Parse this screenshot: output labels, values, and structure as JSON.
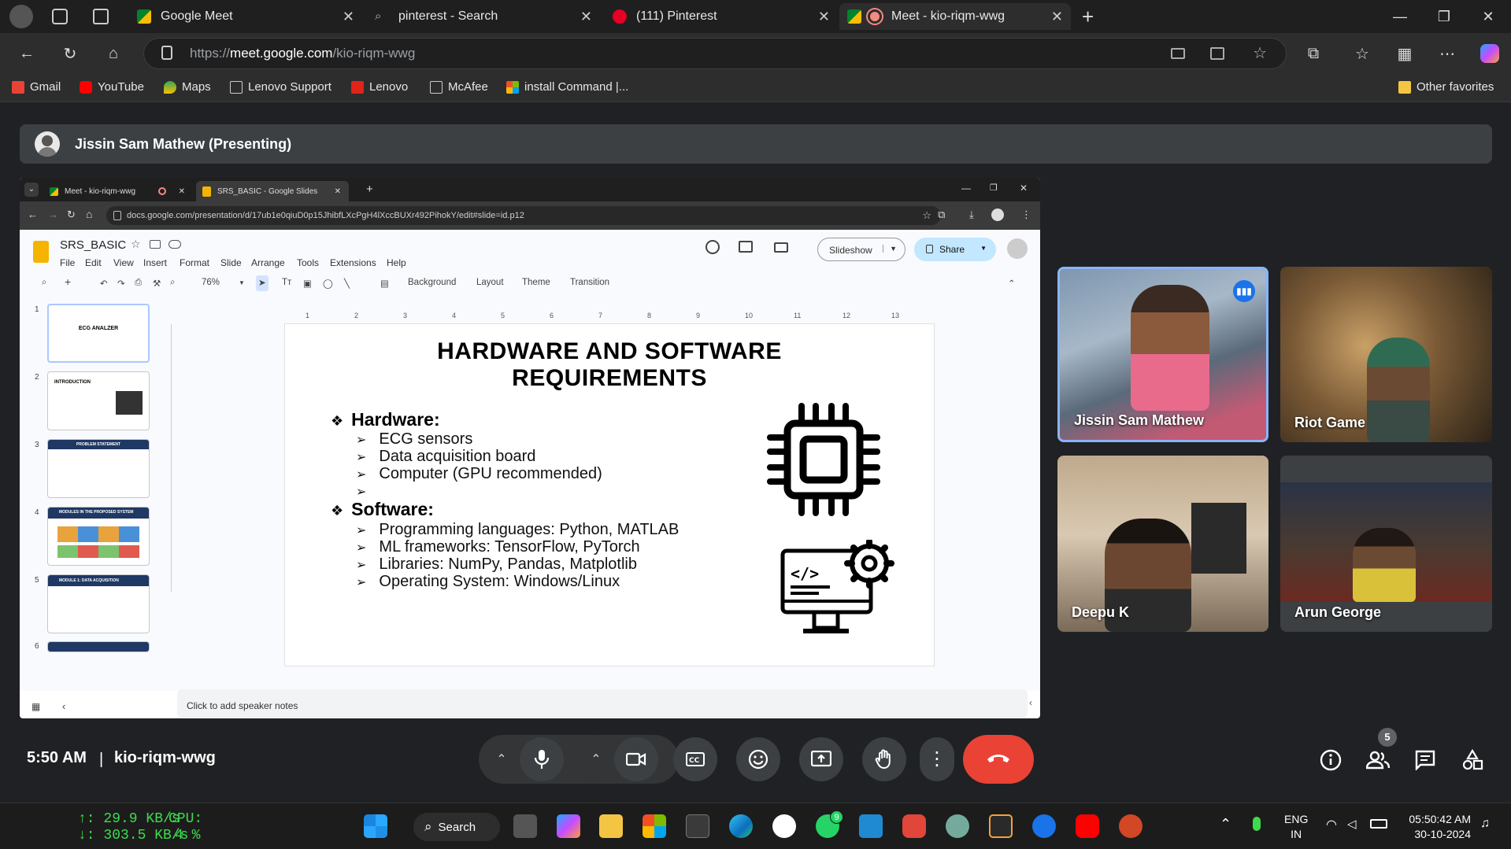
{
  "browser": {
    "tabs": [
      {
        "title": "Google Meet"
      },
      {
        "title": "pinterest - Search"
      },
      {
        "title": "(111) Pinterest"
      },
      {
        "title": "Meet - kio-riqm-wwg"
      }
    ],
    "url": {
      "prefix": "https://",
      "host": "meet.google.com",
      "path": "/kio-riqm-wwg"
    },
    "bookmarks": [
      "Gmail",
      "YouTube",
      "Maps",
      "Lenovo Support",
      "Lenovo",
      "McAfee",
      "install Command |...",
      "Other favorites"
    ]
  },
  "meet": {
    "presenting_banner": "Jissin Sam Mathew (Presenting)",
    "time": "5:50 AM",
    "meeting_code": "kio-riqm-wwg",
    "participants_count": "5",
    "participants": [
      {
        "name": "Jissin Sam Mathew"
      },
      {
        "name": "Riot Game"
      },
      {
        "name": "Deepu K"
      },
      {
        "name": "Arun George"
      }
    ],
    "accent_color": "#8ab4f8",
    "hangup_color": "#ea4335"
  },
  "shared": {
    "tabs": [
      "Meet - kio-riqm-wwg",
      "SRS_BASIC - Google Slides"
    ],
    "url": "docs.google.com/presentation/d/17ub1e0qiuD0p15JhibfLXcPgH4lXccBUXr492PihokY/edit#slide=id.p12",
    "doc_title": "SRS_BASIC",
    "menus": [
      "File",
      "Edit",
      "View",
      "Insert",
      "Format",
      "Slide",
      "Arrange",
      "Tools",
      "Extensions",
      "Help"
    ],
    "zoom": "76%",
    "toolbar_text": [
      "Background",
      "Layout",
      "Theme",
      "Transition"
    ],
    "slideshow_label": "Slideshow",
    "share_label": "Share",
    "ruler": [
      "1",
      "2",
      "3",
      "4",
      "5",
      "6",
      "7",
      "8",
      "9",
      "10",
      "11",
      "12",
      "13"
    ],
    "thumbnails": [
      {
        "num": "1",
        "title": "ECG ANALZER"
      },
      {
        "num": "2",
        "title": "INTRODUCTION"
      },
      {
        "num": "3",
        "title": "PROBLEM STATEMENT"
      },
      {
        "num": "4",
        "title": "MODULES IN THE PROPOSED SYSTEM"
      },
      {
        "num": "5",
        "title": "MODULE 1: DATA ACQUISITION"
      },
      {
        "num": "6",
        "title": ""
      }
    ],
    "speaker_notes": "Click to add speaker notes",
    "slide": {
      "title_line1": "HARDWARE AND SOFTWARE",
      "title_line2": "REQUIREMENTS",
      "hardware_heading": "Hardware:",
      "hardware_items": [
        "ECG sensors",
        "Data acquisition board",
        "Computer (GPU recommended)",
        ""
      ],
      "software_heading": "Software:",
      "software_items": [
        "Programming languages: Python, MATLAB",
        "ML frameworks: TensorFlow, PyTorch",
        "Libraries: NumPy, Pandas, Matplotlib",
        "Operating System: Windows/Linux"
      ]
    }
  },
  "taskbar": {
    "net_up": "↑: 29.9 KB/s",
    "net_down": "↓: 303.5 KB/s",
    "cpu_label": "CPU:",
    "cpu_value": "4 %",
    "search_label": "Search",
    "whatsapp_badge": "9",
    "lang": "ENG",
    "region": "IN",
    "time": "05:50:42 AM",
    "date": "30-10-2024"
  }
}
